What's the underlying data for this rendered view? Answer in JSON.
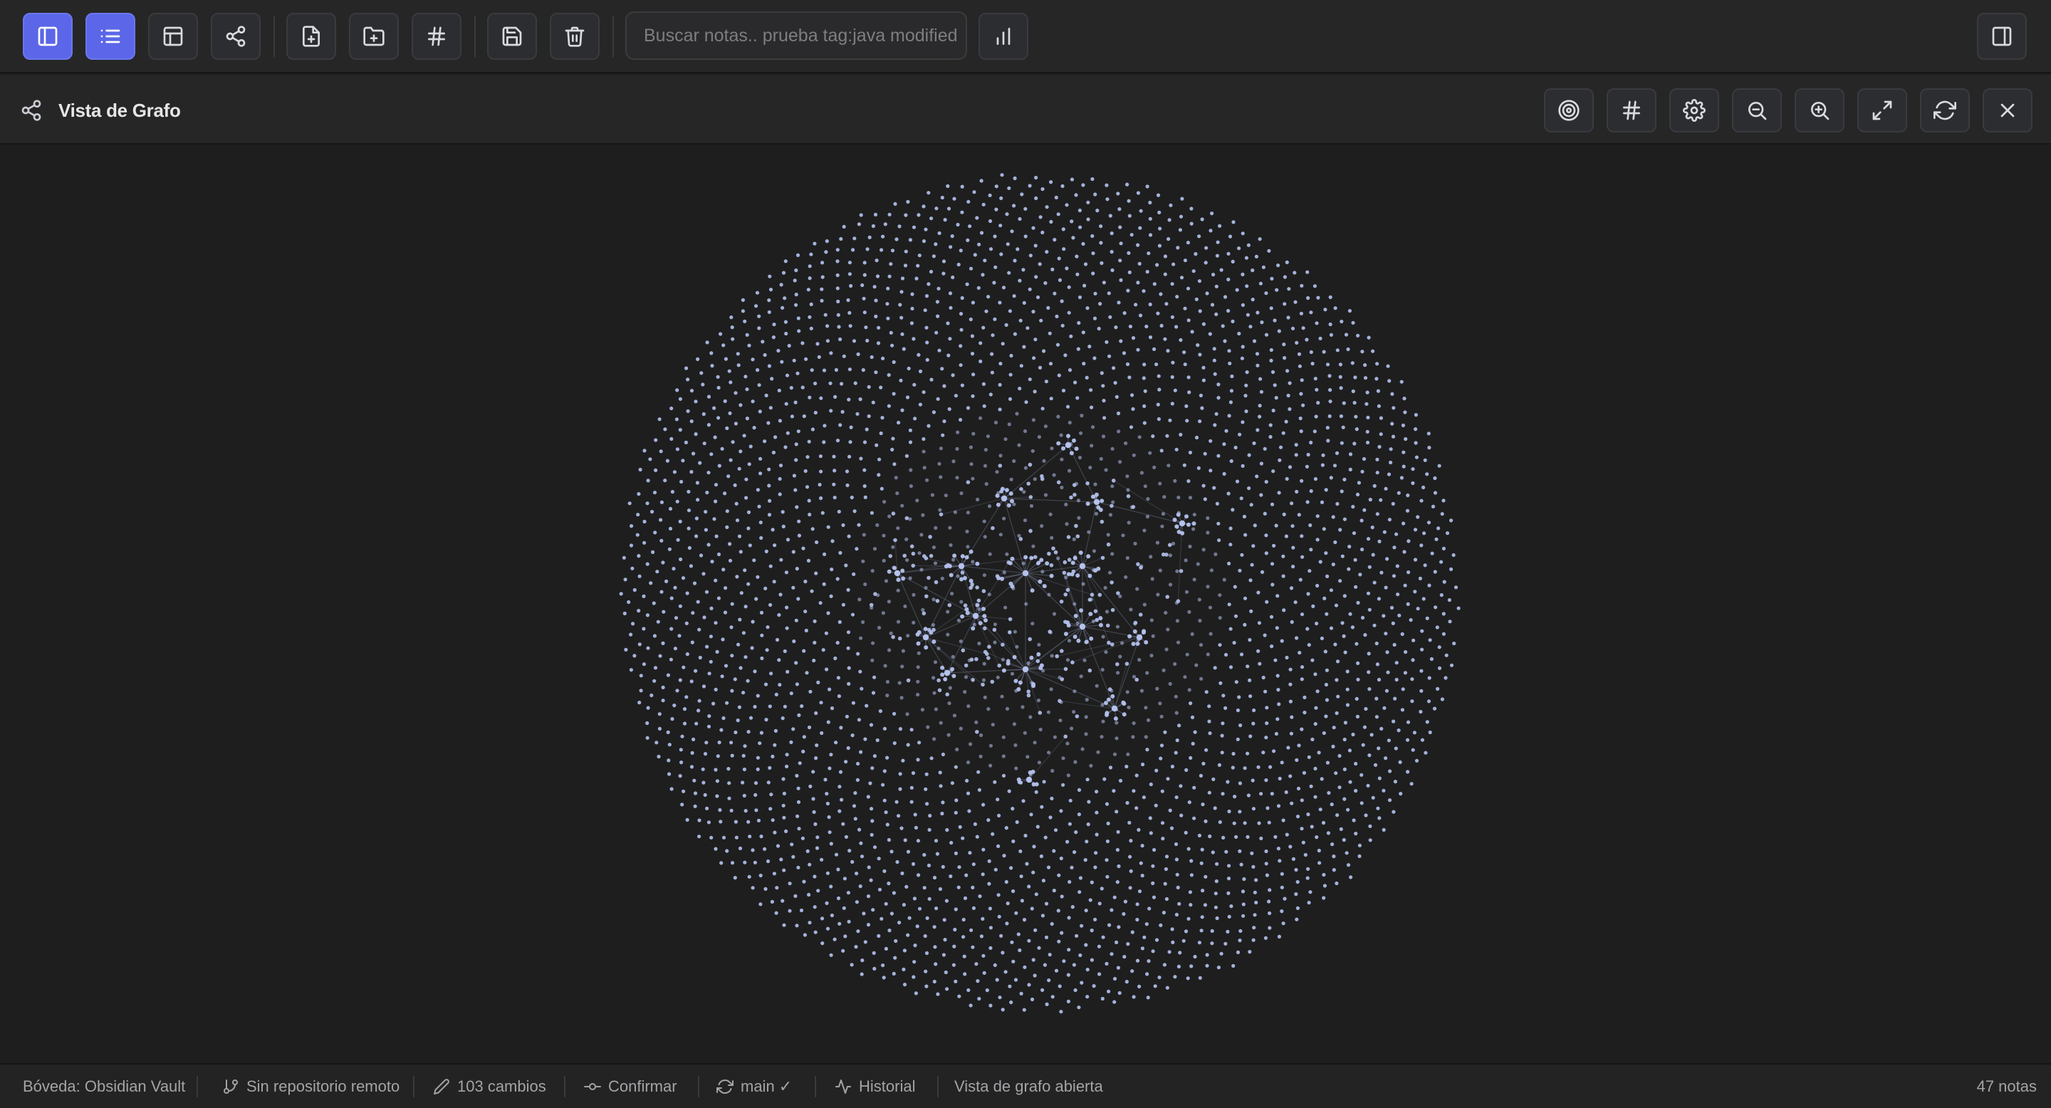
{
  "toolbar": {
    "buttons": [
      {
        "name": "toggle-sidebar-button",
        "icon": "sidebar-left-icon",
        "active": true
      },
      {
        "name": "list-view-button",
        "icon": "list-icon",
        "active": true
      },
      {
        "name": "layout-button",
        "icon": "layout-icon",
        "active": false
      },
      {
        "name": "graph-view-button",
        "icon": "share-icon",
        "active": false
      },
      {
        "name": "new-note-button",
        "icon": "file-plus-icon",
        "active": false
      },
      {
        "name": "new-folder-button",
        "icon": "folder-plus-icon",
        "active": false
      },
      {
        "name": "tags-button",
        "icon": "hash-icon",
        "active": false
      },
      {
        "name": "save-button",
        "icon": "save-icon",
        "active": false
      },
      {
        "name": "delete-button",
        "icon": "trash-icon",
        "active": false
      },
      {
        "name": "stats-button",
        "icon": "bar-chart-icon",
        "active": false
      },
      {
        "name": "toggle-right-panel-button",
        "icon": "sidebar-right-icon",
        "active": false
      }
    ],
    "search_placeholder": "Buscar notas.. prueba tag:java modified",
    "accent_color": "#5b67e8"
  },
  "panel": {
    "title": "Vista de Grafo",
    "title_icon": "share-icon",
    "buttons": [
      {
        "name": "focus-button",
        "icon": "target-icon"
      },
      {
        "name": "tags-filter-button",
        "icon": "hash-icon"
      },
      {
        "name": "graph-settings-button",
        "icon": "gear-icon"
      },
      {
        "name": "zoom-out-button",
        "icon": "zoom-out-icon"
      },
      {
        "name": "zoom-in-button",
        "icon": "zoom-in-icon"
      },
      {
        "name": "fullscreen-button",
        "icon": "expand-icon"
      },
      {
        "name": "refresh-button",
        "icon": "refresh-icon"
      },
      {
        "name": "close-graph-button",
        "icon": "close-icon"
      }
    ]
  },
  "graph": {
    "node_color": "#b4c2ee",
    "edge_color": "#6d7388",
    "background": "#1e1e1e"
  },
  "status": {
    "vault": "Bóveda: Obsidian Vault",
    "remote": "Sin repositorio remoto",
    "changes": "103 cambios",
    "commit": "Confirmar",
    "branch": "main ✓",
    "history": "Historial",
    "graph_state": "Vista de grafo abierta",
    "notes_count": "47 notas"
  }
}
